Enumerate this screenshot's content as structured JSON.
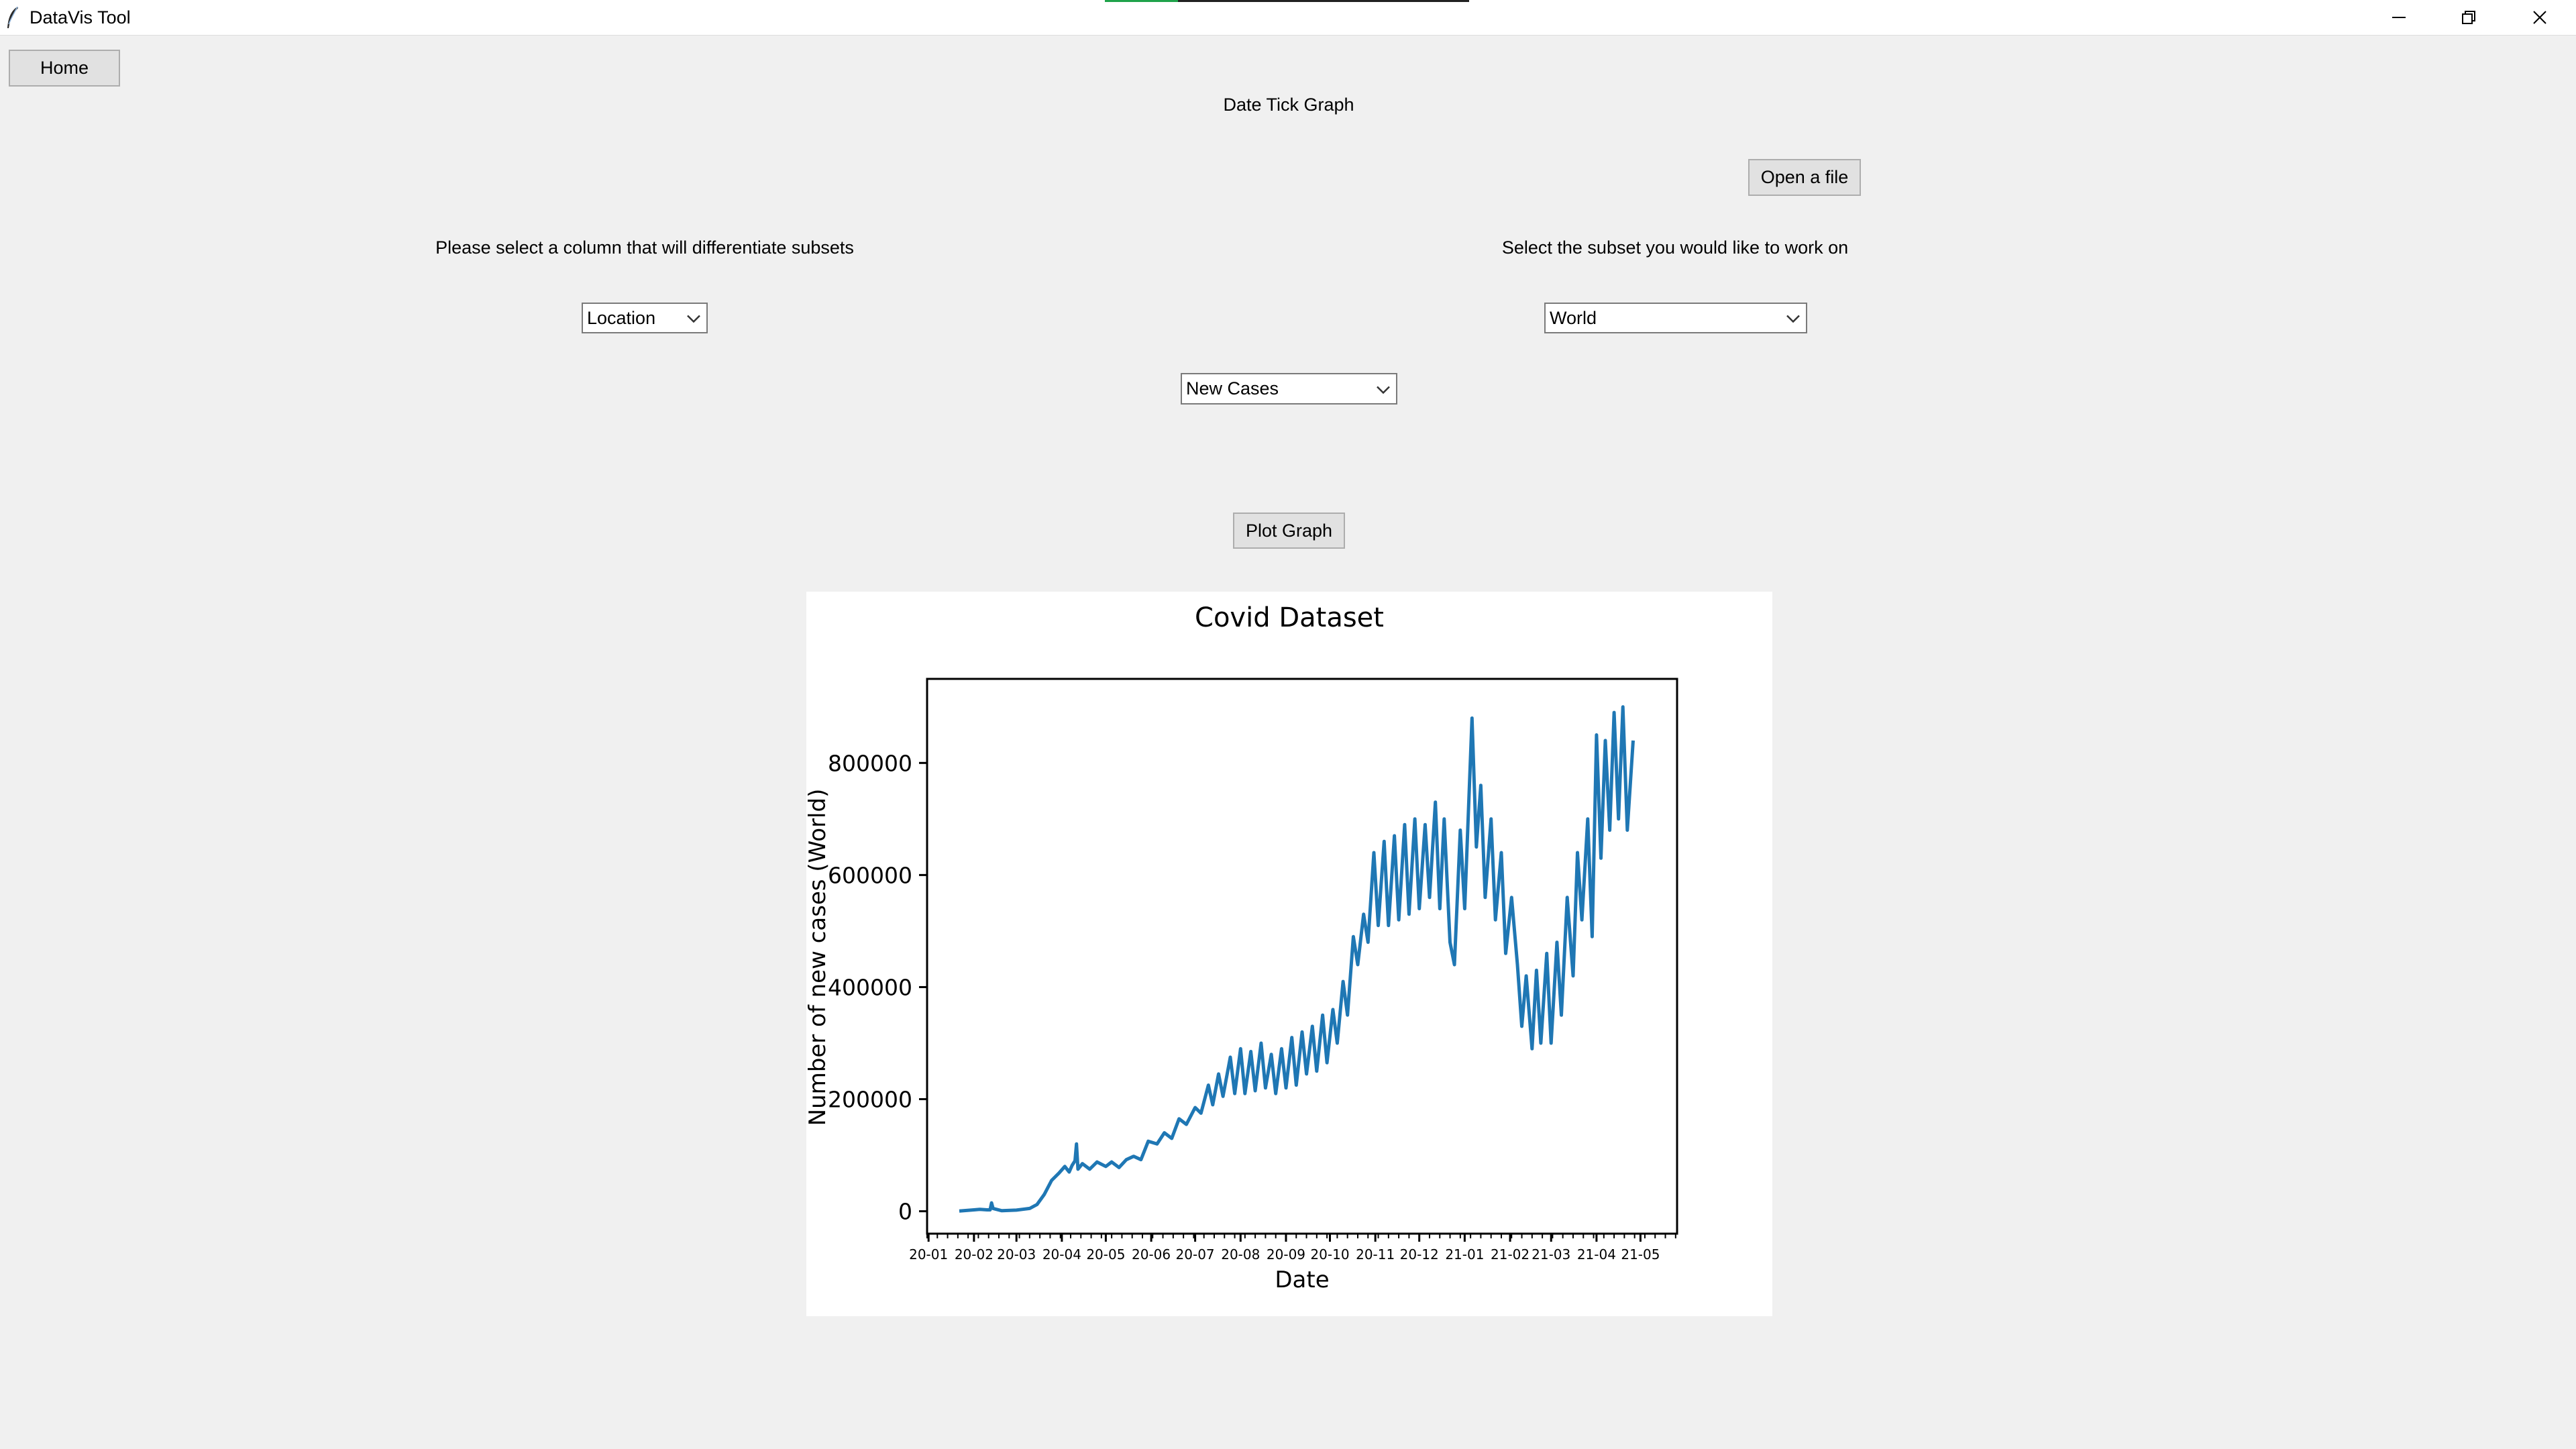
{
  "window": {
    "title": "DataVis Tool",
    "loading_progress": 0.2
  },
  "toolbar": {
    "home_label": "Home"
  },
  "page": {
    "heading": "Date Tick Graph"
  },
  "controls": {
    "open_file_label": "Open a file",
    "column_prompt": "Please select a column that will differentiate subsets",
    "subset_prompt": "Select the subset you would like to work on",
    "column_select_value": "Location",
    "subset_select_value": "World",
    "metric_select_value": "New Cases",
    "plot_label": "Plot Graph"
  },
  "icons": {
    "app": "feather-icon",
    "minimize": "minimize-icon",
    "restore": "restore-icon",
    "close": "close-icon",
    "dropdown": "chevron-down-icon"
  },
  "colors": {
    "series": "#1f77b4",
    "background": "#f0f0f0",
    "progress": "#1fa34a"
  },
  "chart_data": {
    "type": "line",
    "title": "Covid Dataset",
    "xlabel": "Date",
    "ylabel": "Number of new cases (World)",
    "x_ticks": [
      "20-01",
      "20-02",
      "20-03",
      "20-04",
      "20-05",
      "20-06",
      "20-07",
      "20-08",
      "20-09",
      "20-10",
      "20-11",
      "20-12",
      "21-01",
      "21-02",
      "21-03",
      "21-04",
      "21-05"
    ],
    "y_ticks": [
      0,
      200000,
      400000,
      600000,
      800000
    ],
    "xlim": [
      "2019-12-31",
      "2021-05-26"
    ],
    "ylim": [
      -40000,
      950000
    ],
    "grid": false,
    "series": [
      {
        "values": [
          [
            "2020-01-22",
            500
          ],
          [
            "2020-02-01",
            2500
          ],
          [
            "2020-02-05",
            3500
          ],
          [
            "2020-02-10",
            2500
          ],
          [
            "2020-02-12",
            2500
          ],
          [
            "2020-02-13",
            15000
          ],
          [
            "2020-02-14",
            5000
          ],
          [
            "2020-02-20",
            1000
          ],
          [
            "2020-03-01",
            2000
          ],
          [
            "2020-03-10",
            5000
          ],
          [
            "2020-03-15",
            12000
          ],
          [
            "2020-03-20",
            30000
          ],
          [
            "2020-03-25",
            55000
          ],
          [
            "2020-03-30",
            68000
          ],
          [
            "2020-04-03",
            80000
          ],
          [
            "2020-04-06",
            70000
          ],
          [
            "2020-04-08",
            82000
          ],
          [
            "2020-04-10",
            90000
          ],
          [
            "2020-04-11",
            120000
          ],
          [
            "2020-04-12",
            75000
          ],
          [
            "2020-04-15",
            85000
          ],
          [
            "2020-04-20",
            75000
          ],
          [
            "2020-04-25",
            88000
          ],
          [
            "2020-05-01",
            80000
          ],
          [
            "2020-05-05",
            88000
          ],
          [
            "2020-05-10",
            78000
          ],
          [
            "2020-05-15",
            92000
          ],
          [
            "2020-05-20",
            98000
          ],
          [
            "2020-05-25",
            92000
          ],
          [
            "2020-05-30",
            125000
          ],
          [
            "2020-06-05",
            120000
          ],
          [
            "2020-06-10",
            140000
          ],
          [
            "2020-06-15",
            130000
          ],
          [
            "2020-06-20",
            165000
          ],
          [
            "2020-06-25",
            155000
          ],
          [
            "2020-07-01",
            185000
          ],
          [
            "2020-07-05",
            175000
          ],
          [
            "2020-07-10",
            225000
          ],
          [
            "2020-07-13",
            190000
          ],
          [
            "2020-07-17",
            245000
          ],
          [
            "2020-07-20",
            205000
          ],
          [
            "2020-07-25",
            275000
          ],
          [
            "2020-07-28",
            210000
          ],
          [
            "2020-08-01",
            290000
          ],
          [
            "2020-08-04",
            210000
          ],
          [
            "2020-08-08",
            285000
          ],
          [
            "2020-08-11",
            215000
          ],
          [
            "2020-08-15",
            300000
          ],
          [
            "2020-08-18",
            220000
          ],
          [
            "2020-08-22",
            280000
          ],
          [
            "2020-08-25",
            210000
          ],
          [
            "2020-08-29",
            290000
          ],
          [
            "2020-09-01",
            220000
          ],
          [
            "2020-09-05",
            310000
          ],
          [
            "2020-09-08",
            225000
          ],
          [
            "2020-09-12",
            320000
          ],
          [
            "2020-09-15",
            245000
          ],
          [
            "2020-09-19",
            330000
          ],
          [
            "2020-09-22",
            250000
          ],
          [
            "2020-09-26",
            350000
          ],
          [
            "2020-09-29",
            265000
          ],
          [
            "2020-10-03",
            360000
          ],
          [
            "2020-10-06",
            300000
          ],
          [
            "2020-10-10",
            410000
          ],
          [
            "2020-10-13",
            350000
          ],
          [
            "2020-10-17",
            490000
          ],
          [
            "2020-10-20",
            440000
          ],
          [
            "2020-10-24",
            530000
          ],
          [
            "2020-10-27",
            480000
          ],
          [
            "2020-10-31",
            640000
          ],
          [
            "2020-11-03",
            510000
          ],
          [
            "2020-11-07",
            660000
          ],
          [
            "2020-11-10",
            510000
          ],
          [
            "2020-11-14",
            670000
          ],
          [
            "2020-11-17",
            520000
          ],
          [
            "2020-11-21",
            690000
          ],
          [
            "2020-11-24",
            530000
          ],
          [
            "2020-11-28",
            700000
          ],
          [
            "2020-12-01",
            540000
          ],
          [
            "2020-12-05",
            690000
          ],
          [
            "2020-12-08",
            560000
          ],
          [
            "2020-12-12",
            730000
          ],
          [
            "2020-12-15",
            540000
          ],
          [
            "2020-12-18",
            700000
          ],
          [
            "2020-12-22",
            480000
          ],
          [
            "2020-12-25",
            440000
          ],
          [
            "2020-12-29",
            680000
          ],
          [
            "2021-01-01",
            540000
          ],
          [
            "2021-01-06",
            880000
          ],
          [
            "2021-01-09",
            650000
          ],
          [
            "2021-01-12",
            760000
          ],
          [
            "2021-01-15",
            560000
          ],
          [
            "2021-01-19",
            700000
          ],
          [
            "2021-01-22",
            520000
          ],
          [
            "2021-01-26",
            640000
          ],
          [
            "2021-01-29",
            460000
          ],
          [
            "2021-02-02",
            560000
          ],
          [
            "2021-02-06",
            440000
          ],
          [
            "2021-02-09",
            330000
          ],
          [
            "2021-02-12",
            420000
          ],
          [
            "2021-02-16",
            290000
          ],
          [
            "2021-02-19",
            430000
          ],
          [
            "2021-02-22",
            300000
          ],
          [
            "2021-02-26",
            460000
          ],
          [
            "2021-03-01",
            300000
          ],
          [
            "2021-03-05",
            480000
          ],
          [
            "2021-03-08",
            350000
          ],
          [
            "2021-03-12",
            560000
          ],
          [
            "2021-03-16",
            420000
          ],
          [
            "2021-03-19",
            640000
          ],
          [
            "2021-03-22",
            520000
          ],
          [
            "2021-03-26",
            700000
          ],
          [
            "2021-03-29",
            490000
          ],
          [
            "2021-04-01",
            850000
          ],
          [
            "2021-04-04",
            630000
          ],
          [
            "2021-04-07",
            840000
          ],
          [
            "2021-04-10",
            680000
          ],
          [
            "2021-04-13",
            890000
          ],
          [
            "2021-04-16",
            700000
          ],
          [
            "2021-04-19",
            900000
          ],
          [
            "2021-04-22",
            680000
          ],
          [
            "2021-04-26",
            840000
          ]
        ]
      }
    ]
  }
}
